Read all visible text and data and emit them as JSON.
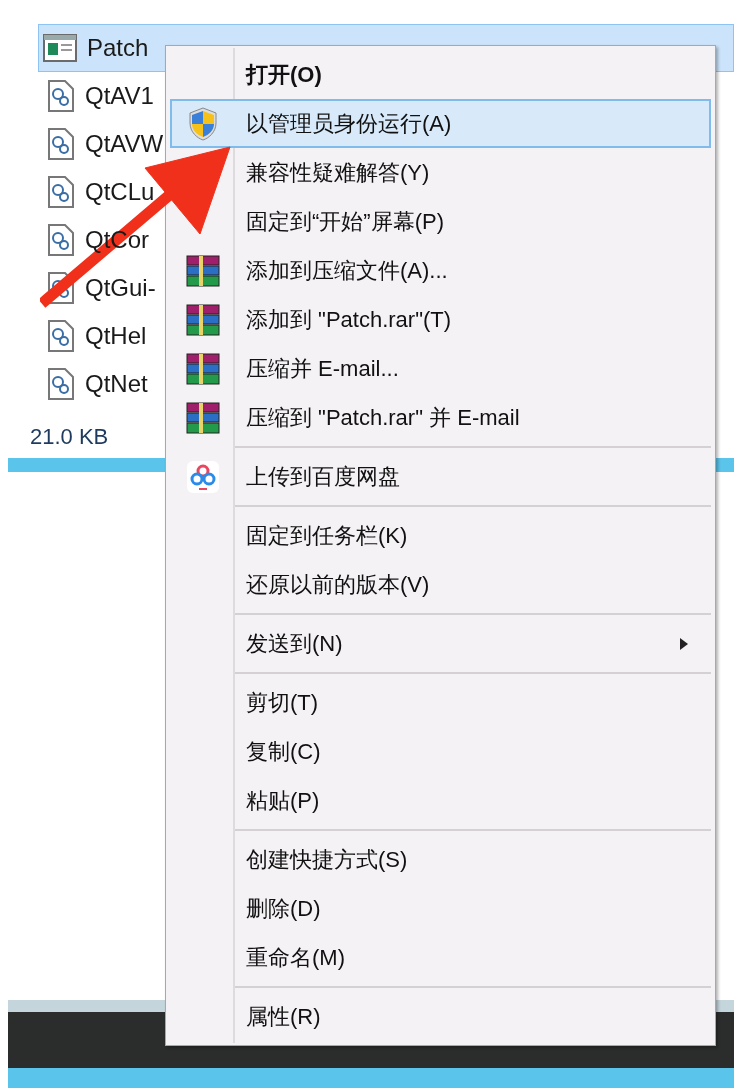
{
  "files": [
    {
      "name": "Patch",
      "kind": "app",
      "selected": true
    },
    {
      "name": "QtAV1",
      "kind": "dll",
      "selected": false
    },
    {
      "name": "QtAVW",
      "kind": "dll",
      "selected": false
    },
    {
      "name": "QtCLu",
      "kind": "dll",
      "selected": false
    },
    {
      "name": "QtCor",
      "kind": "dll",
      "selected": false
    },
    {
      "name": "QtGui-",
      "kind": "dll",
      "selected": false
    },
    {
      "name": "QtHel",
      "kind": "dll",
      "selected": false
    },
    {
      "name": "QtNet",
      "kind": "dll",
      "selected": false
    }
  ],
  "status_bar": {
    "size": "21.0 KB"
  },
  "context_menu": [
    {
      "kind": "plain",
      "label": "打开(O)",
      "bold": true,
      "selected": false
    },
    {
      "kind": "admin",
      "label": "以管理员身份运行(A)",
      "bold": false,
      "selected": true
    },
    {
      "kind": "plain",
      "label": "兼容性疑难解答(Y)",
      "bold": false,
      "selected": false
    },
    {
      "kind": "plain",
      "label": "固定到“开始”屏幕(P)",
      "bold": false,
      "selected": false
    },
    {
      "kind": "archive",
      "label": "添加到压缩文件(A)...",
      "bold": false,
      "selected": false
    },
    {
      "kind": "archive",
      "label": "添加到 \"Patch.rar\"(T)",
      "bold": false,
      "selected": false
    },
    {
      "kind": "archive",
      "label": "压缩并 E-mail...",
      "bold": false,
      "selected": false
    },
    {
      "kind": "archive",
      "label": "压缩到 \"Patch.rar\" 并 E-mail",
      "bold": false,
      "selected": false
    },
    {
      "kind": "separator"
    },
    {
      "kind": "cloud",
      "label": "上传到百度网盘",
      "bold": false,
      "selected": false
    },
    {
      "kind": "separator"
    },
    {
      "kind": "plain",
      "label": "固定到任务栏(K)",
      "bold": false,
      "selected": false
    },
    {
      "kind": "plain",
      "label": "还原以前的版本(V)",
      "bold": false,
      "selected": false
    },
    {
      "kind": "separator"
    },
    {
      "kind": "plain",
      "label": "发送到(N)",
      "bold": false,
      "selected": false,
      "submenu": true
    },
    {
      "kind": "separator"
    },
    {
      "kind": "plain",
      "label": "剪切(T)",
      "bold": false,
      "selected": false
    },
    {
      "kind": "plain",
      "label": "复制(C)",
      "bold": false,
      "selected": false
    },
    {
      "kind": "plain",
      "label": "粘贴(P)",
      "bold": false,
      "selected": false
    },
    {
      "kind": "separator"
    },
    {
      "kind": "plain",
      "label": "创建快捷方式(S)",
      "bold": false,
      "selected": false
    },
    {
      "kind": "plain",
      "label": "删除(D)",
      "bold": false,
      "selected": false
    },
    {
      "kind": "plain",
      "label": "重命名(M)",
      "bold": false,
      "selected": false
    },
    {
      "kind": "separator"
    },
    {
      "kind": "plain",
      "label": "属性(R)",
      "bold": false,
      "selected": false
    }
  ]
}
